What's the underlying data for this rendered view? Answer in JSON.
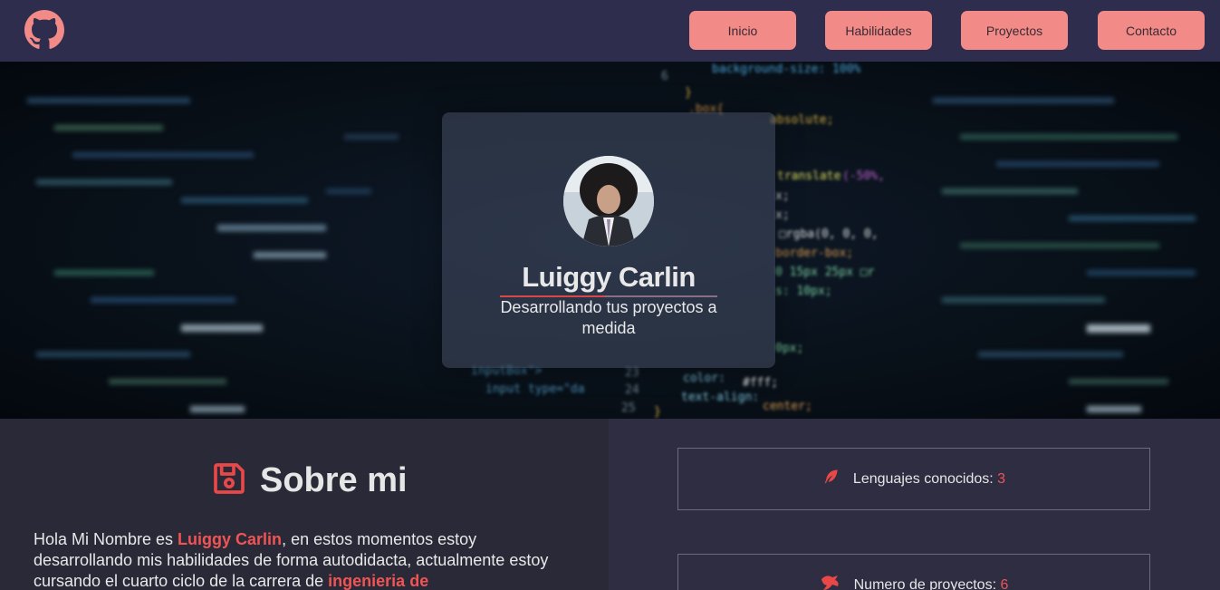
{
  "nav": {
    "logo": "github-icon",
    "items": [
      {
        "label": "Inicio"
      },
      {
        "label": "Habilidades"
      },
      {
        "label": "Proyectos"
      },
      {
        "label": "Contacto"
      }
    ]
  },
  "hero": {
    "name": "Luiggy Carlin",
    "subtitle": "Desarrollando tus proyectos a medida"
  },
  "about": {
    "title": "Sobre mi",
    "icon": "floppy-disk-icon",
    "text_1": "Hola Mi Nombre es ",
    "name_highlight": "Luiggy Carlin",
    "text_2": ", en estos momentos estoy desarrollando mis habilidades de forma autodidacta, actualmente estoy cursando el cuarto ciclo de la carrera de ",
    "career_highlight": "ingenieria de"
  },
  "stats": [
    {
      "icon": "feather-icon",
      "label": "Lenguajes conocidos:",
      "value": "3"
    },
    {
      "icon": "dragon-icon",
      "label": "Numero de proyectos:",
      "value": "6"
    }
  ],
  "colors": {
    "nav_bg": "#2e2d4d",
    "accent": "#f28b87",
    "highlight": "#f05454",
    "about_bg": "#2a2938",
    "stats_bg": "#2e2d42"
  }
}
